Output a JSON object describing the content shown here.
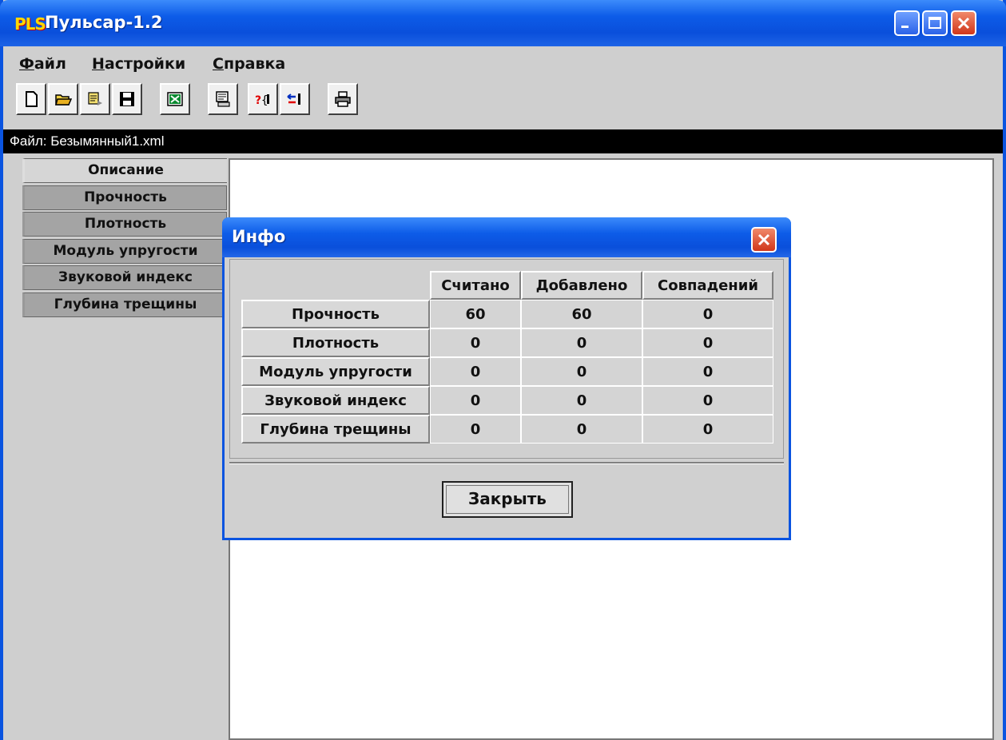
{
  "window": {
    "logo": "PLS",
    "title": "Пульсар-1.2"
  },
  "menu": [
    {
      "label": "Файл",
      "underline": "Ф",
      "rest": "айл"
    },
    {
      "label": "Настройки",
      "underline": "Н",
      "rest": "астройки"
    },
    {
      "label": "Справка",
      "underline": "С",
      "rest": "правка"
    }
  ],
  "toolbar": {
    "icons": [
      "new-document-icon",
      "open-folder-icon",
      "export-icon",
      "save-icon",
      "excel-icon",
      "device-icon",
      "help-query-icon",
      "transfer-icon",
      "print-icon"
    ]
  },
  "filebar": {
    "text": "Файл: Безымянный1.xml"
  },
  "tabs": [
    {
      "label": "Описание",
      "active": true
    },
    {
      "label": "Прочность",
      "active": false
    },
    {
      "label": "Плотность",
      "active": false
    },
    {
      "label": "Модуль упругости",
      "active": false
    },
    {
      "label": "Звуковой индекс",
      "active": false
    },
    {
      "label": "Глубина трещины",
      "active": false
    }
  ],
  "dialog": {
    "title": "Инфо",
    "columns": [
      "Считано",
      "Добавлено",
      "Совпадений"
    ],
    "rows": [
      {
        "label": "Прочность",
        "values": [
          "60",
          "60",
          "0"
        ]
      },
      {
        "label": "Плотность",
        "values": [
          "0",
          "0",
          "0"
        ]
      },
      {
        "label": "Модуль упругости",
        "values": [
          "0",
          "0",
          "0"
        ]
      },
      {
        "label": "Звуковой индекс",
        "values": [
          "0",
          "0",
          "0"
        ]
      },
      {
        "label": "Глубина трещины",
        "values": [
          "0",
          "0",
          "0"
        ]
      }
    ],
    "close_label": "Закрыть"
  },
  "colors": {
    "titlebar": "#0a54e0",
    "close_button": "#d0361a",
    "filebar_bg": "#000000"
  }
}
